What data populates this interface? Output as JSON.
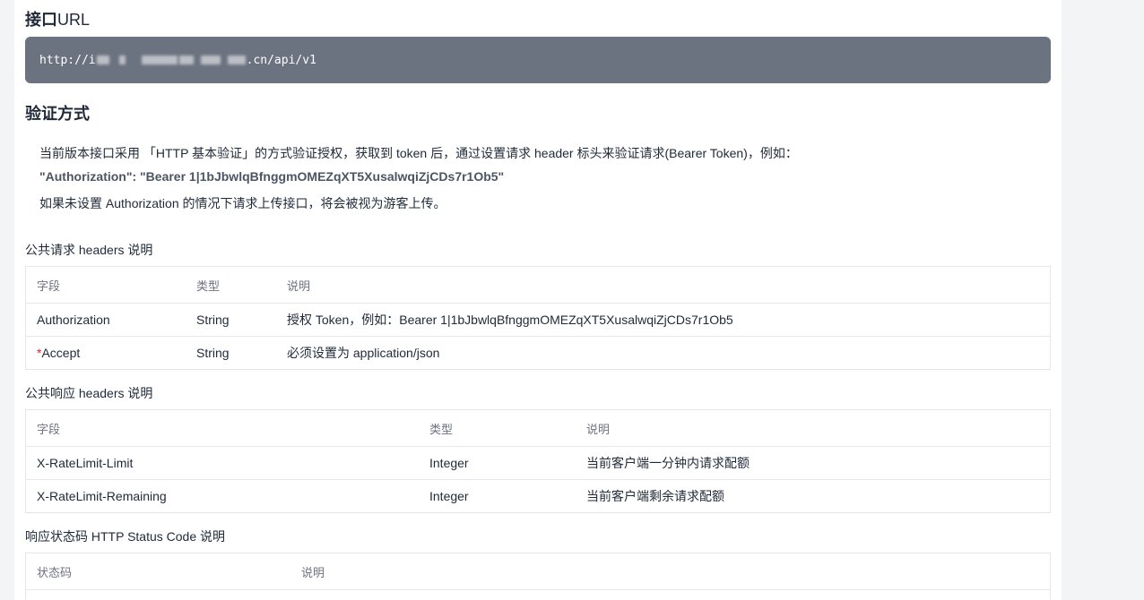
{
  "api_url": {
    "title_zh": "接口",
    "title_en": "URL",
    "url_prefix": "http://i",
    "url_suffix": ".cn/api/v1"
  },
  "auth": {
    "title": "验证方式",
    "line1": "当前版本接口采用 「HTTP 基本验证」的方式验证授权，获取到 token 后，通过设置请求 header 标头来验证请求(Bearer Token)，例如：",
    "example": "\"Authorization\": \"Bearer 1|1bJbwlqBfnggmOMEZqXT5XusalwqiZjCDs7r1Ob5\"",
    "line3": "如果未设置 Authorization 的情况下请求上传接口，将会被视为游客上传。"
  },
  "request_headers": {
    "caption": "公共请求 headers 说明",
    "columns": [
      "字段",
      "类型",
      "说明"
    ],
    "rows": [
      {
        "field": "Authorization",
        "required": "",
        "type": "String",
        "desc": "授权 Token，例如：Bearer 1|1bJbwlqBfnggmOMEZqXT5XusalwqiZjCDs7r1Ob5"
      },
      {
        "field": "Accept",
        "required": "*",
        "type": "String",
        "desc": "必须设置为 application/json"
      }
    ]
  },
  "response_headers": {
    "caption": "公共响应 headers 说明",
    "columns": [
      "字段",
      "类型",
      "说明"
    ],
    "rows": [
      {
        "field": "X-RateLimit-Limit",
        "type": "Integer",
        "desc": "当前客户端一分钟内请求配额"
      },
      {
        "field": "X-RateLimit-Remaining",
        "type": "Integer",
        "desc": "当前客户端剩余请求配额"
      }
    ]
  },
  "status_codes": {
    "caption": "响应状态码 HTTP Status Code 说明",
    "columns": [
      "状态码",
      "说明"
    ]
  }
}
